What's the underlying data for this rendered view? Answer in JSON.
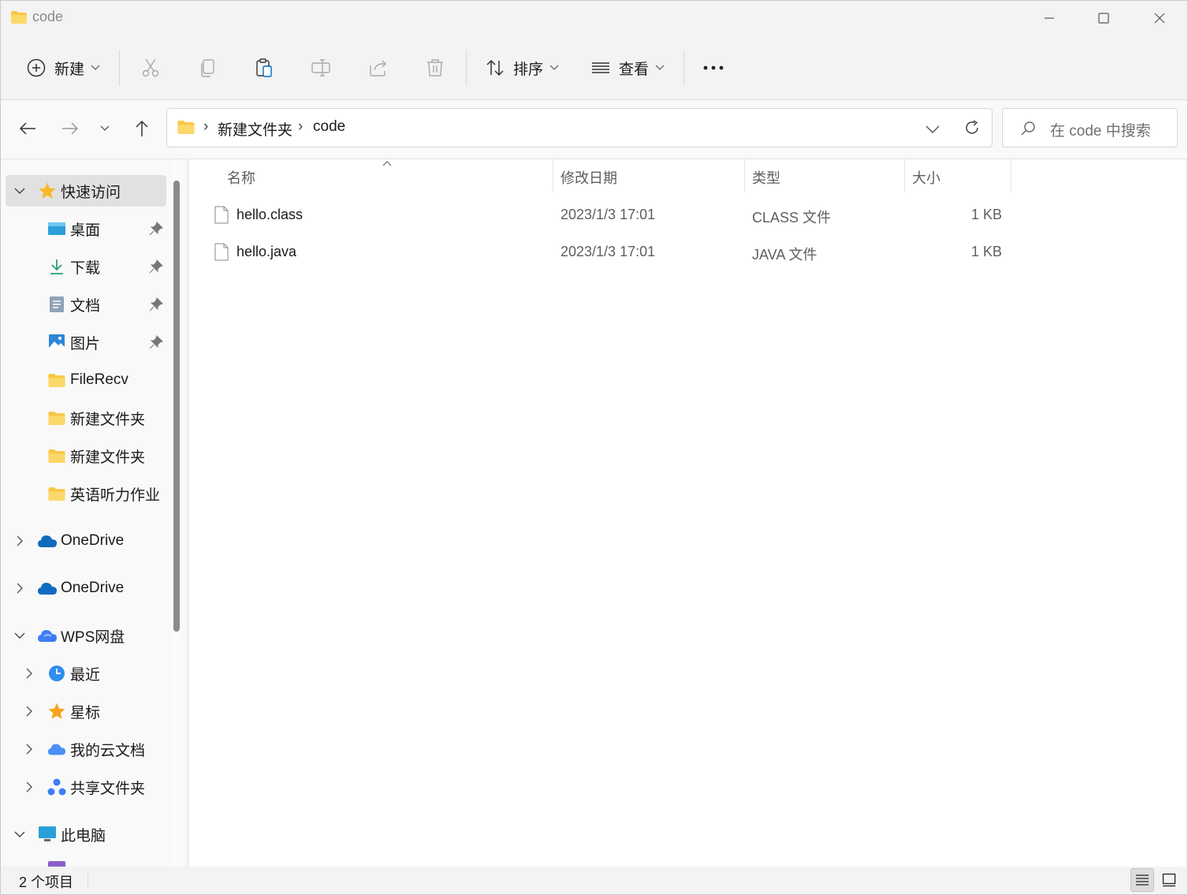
{
  "window": {
    "title": "code",
    "controls": {
      "minimize": "minimize",
      "maximize": "maximize",
      "close": "close"
    }
  },
  "toolbar": {
    "new_label": "新建",
    "sort_label": "排序",
    "view_label": "查看",
    "more_label": "•••",
    "icons": [
      "plus-circle-icon",
      "cut-icon",
      "copy-icon",
      "paste-icon",
      "rename-icon",
      "share-icon",
      "delete-icon",
      "sort-icon",
      "view-list-icon"
    ]
  },
  "address": {
    "crumbs": [
      "新建文件夹",
      "code"
    ],
    "separator": "›"
  },
  "search": {
    "placeholder": "在 code 中搜索"
  },
  "sidebar": {
    "quick_access": "快速访问",
    "items": [
      {
        "label": "桌面",
        "icon": "desktop-icon",
        "pinned": true
      },
      {
        "label": "下载",
        "icon": "download-icon",
        "pinned": true
      },
      {
        "label": "文档",
        "icon": "document-icon",
        "pinned": true
      },
      {
        "label": "图片",
        "icon": "pictures-icon",
        "pinned": true
      },
      {
        "label": "FileRecv",
        "icon": "folder-icon",
        "pinned": false
      },
      {
        "label": "新建文件夹",
        "icon": "folder-icon",
        "pinned": false
      },
      {
        "label": "新建文件夹",
        "icon": "folder-icon",
        "pinned": false
      },
      {
        "label": "英语听力作业",
        "icon": "folder-icon",
        "pinned": false
      }
    ],
    "onedrive_1": "OneDrive",
    "onedrive_2": "OneDrive",
    "wps": "WPS网盘",
    "wps_children": [
      {
        "label": "最近",
        "icon": "clock-icon"
      },
      {
        "label": "星标",
        "icon": "star-icon"
      },
      {
        "label": "我的云文档",
        "icon": "cloud-icon"
      },
      {
        "label": "共享文件夹",
        "icon": "share-folder-icon"
      }
    ],
    "this_pc": "此电脑"
  },
  "columns": {
    "name": "名称",
    "modified": "修改日期",
    "type": "类型",
    "size": "大小"
  },
  "files": [
    {
      "name": "hello.class",
      "modified": "2023/1/3 17:01",
      "type": "CLASS 文件",
      "size": "1 KB"
    },
    {
      "name": "hello.java",
      "modified": "2023/1/3 17:01",
      "type": "JAVA 文件",
      "size": "1 KB"
    }
  ],
  "status": {
    "item_count": "2 个项目"
  },
  "colors": {
    "folder": "#f8c843",
    "accent": "#0067c0",
    "selected_bg": "#e1e1e1"
  }
}
